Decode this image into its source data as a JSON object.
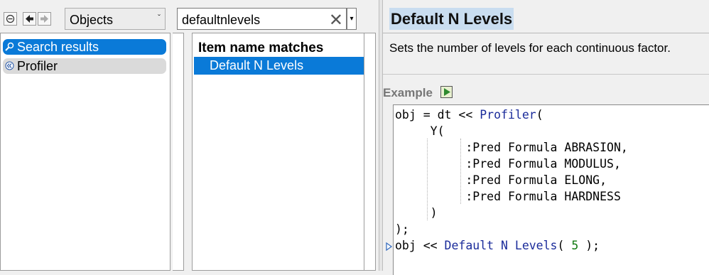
{
  "toolbar": {
    "dropdown_value": "Objects",
    "search_value": "defaultnlevels"
  },
  "left_nav": {
    "items": [
      {
        "label": "Search results",
        "selected": true
      },
      {
        "label": "Profiler",
        "selected": false
      }
    ]
  },
  "matches": {
    "header": "Item name matches",
    "items": [
      "Default N Levels"
    ]
  },
  "help": {
    "title": "Default N Levels",
    "description": "Sets the number of levels for each continuous factor.",
    "example_label": "Example"
  },
  "code": {
    "line1_pre": "obj = dt << ",
    "line1_fn": "Profiler",
    "line1_post": "(",
    "line2": "Y(",
    "line3": ":Pred Formula ABRASION,",
    "line4": ":Pred Formula MODULUS,",
    "line5": ":Pred Formula ELONG,",
    "line6": ":Pred Formula HARDNESS",
    "line7": ")",
    "line8": ");",
    "line9_pre": "obj << ",
    "line9_fn": "Default N Levels",
    "line9_mid": "( ",
    "line9_num": "5",
    "line9_post": " );"
  },
  "colors": {
    "selection": "#0a7ad8",
    "title_highlight": "#c9ddf0",
    "keyword": "#1a2b9a",
    "number": "#107a10"
  }
}
